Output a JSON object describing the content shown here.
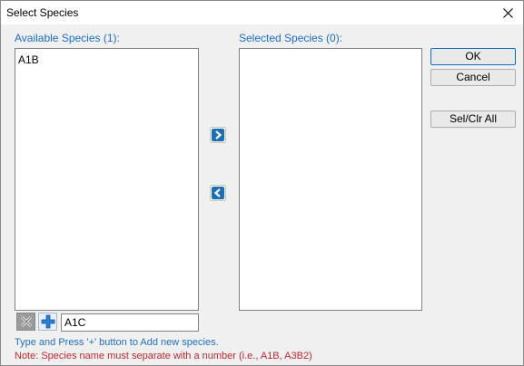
{
  "window": {
    "title": "Select Species"
  },
  "available": {
    "label": "Available Species (1):",
    "items": [
      "A1B"
    ]
  },
  "selected": {
    "label": "Selected Species (0):",
    "items": []
  },
  "buttons": {
    "ok": "OK",
    "cancel": "Cancel",
    "sel_clr_all": "Sel/Clr All"
  },
  "new_species": {
    "value": "A1C"
  },
  "hints": {
    "instruction": "Type and Press '+' button to Add new species.",
    "note": "Note: Species name must separate with a number (i.e., A1B, A3B2)"
  },
  "icons": {
    "close": "close-icon",
    "move_right": "chevron-right-icon",
    "move_left": "chevron-left-icon",
    "delete": "delete-x-icon",
    "add": "plus-icon"
  },
  "colors": {
    "label_blue": "#1f6fc5",
    "note_red": "#c0282e",
    "arrow_blue": "#1a6fb5"
  }
}
